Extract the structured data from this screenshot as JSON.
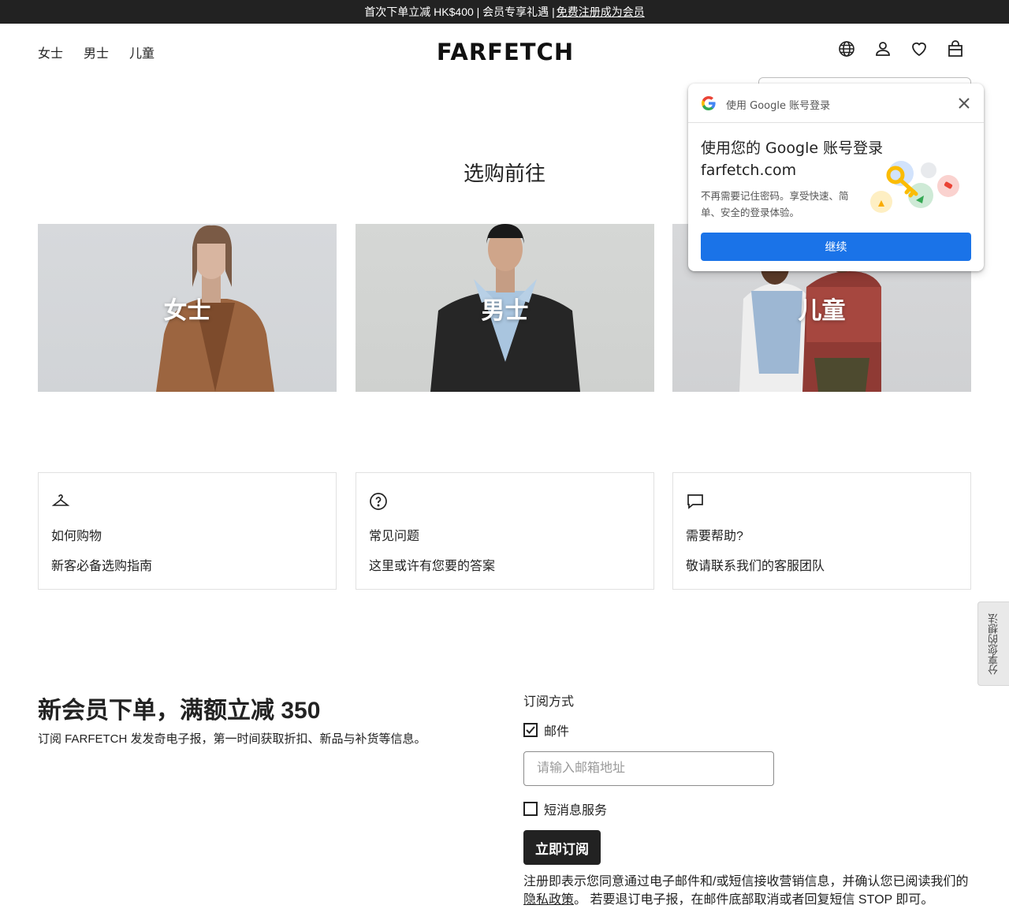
{
  "topbar": {
    "promo_text": "首次下单立减 HK$400 | 会员专享礼遇 |",
    "register_link": "免费注册成为会员"
  },
  "header": {
    "nav": [
      "女士",
      "男士",
      "儿童"
    ],
    "logo": "FARFETCH",
    "icons": [
      "globe-icon",
      "account-icon",
      "heart-icon",
      "bag-icon"
    ]
  },
  "shop_section": {
    "title": "选购前往",
    "categories": [
      {
        "label": "女士"
      },
      {
        "label": "男士"
      },
      {
        "label": "儿童"
      }
    ]
  },
  "help_cards": [
    {
      "icon": "hanger-icon",
      "title": "如何购物",
      "subtitle": "新客必备选购指南"
    },
    {
      "icon": "question-icon",
      "title": "常见问题",
      "subtitle": "这里或许有您要的答案"
    },
    {
      "icon": "chat-icon",
      "title": "需要帮助?",
      "subtitle": "敬请联系我们的客服团队"
    }
  ],
  "feedback_tab": "分享您的想法",
  "newsletter": {
    "title": "新会员下单，满额立减 350",
    "subtitle": "订阅 FARFETCH 发发奇电子报，第一时间获取折扣、新品与补货等信息。",
    "method_label": "订阅方式",
    "email_option": {
      "label": "邮件",
      "checked": true
    },
    "email_placeholder": "请输入邮箱地址",
    "sms_option": {
      "label": "短消息服务",
      "checked": false
    },
    "submit": "立即订阅",
    "terms_before": "注册即表示您同意通过电子邮件和/或短信接收营销信息，并确认您已阅读我们的",
    "privacy_link": "隐私政策",
    "terms_after": "。 若要退订电子报，在邮件底部取消或者回复短信 STOP 即可。"
  },
  "google_popup": {
    "header": "使用 Google 账号登录",
    "title": "使用您的 Google 账号登录 farfetch.com",
    "description": "不再需要记住密码。享受快速、简单、安全的登录体验。",
    "button": "继续",
    "brand_color": "#1a73e8"
  }
}
